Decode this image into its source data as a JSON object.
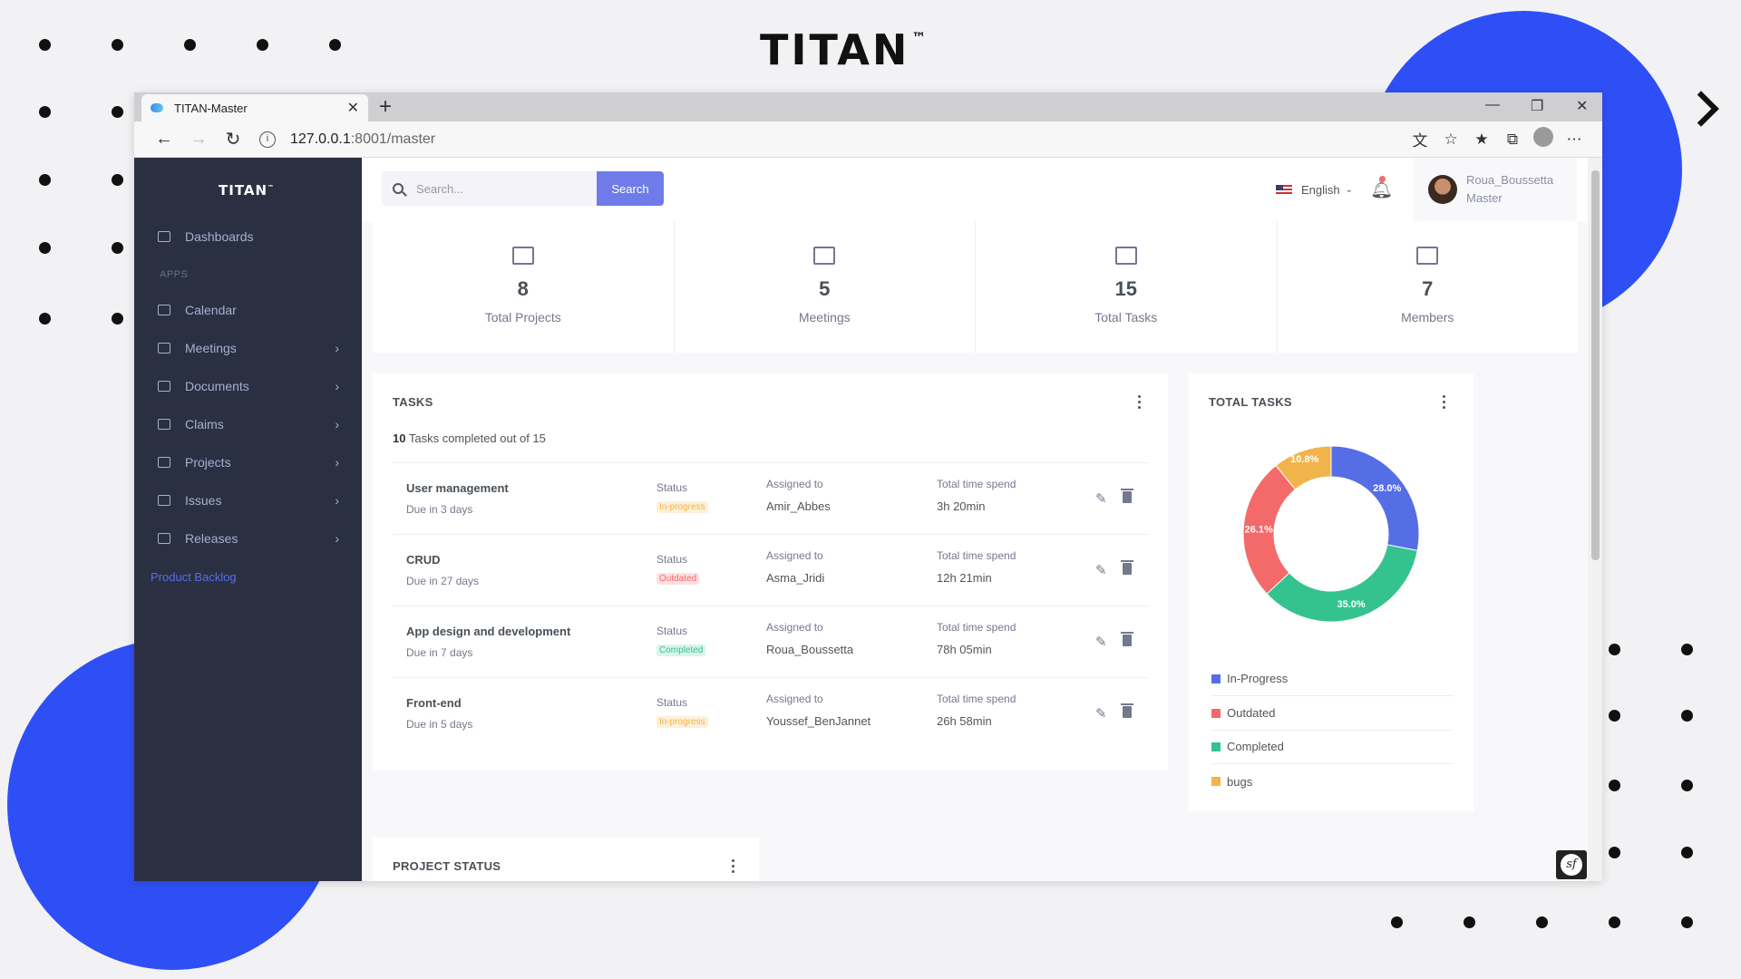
{
  "brand": {
    "name": "TITAN",
    "tm": "™"
  },
  "browser": {
    "tab_title": "TITAN-Master",
    "url_host": "127.0.0.1",
    "url_rest": ":8001/master"
  },
  "sidebar": {
    "brand": "TITAN",
    "brand_tm": "™",
    "items": [
      {
        "label": "Dashboards",
        "icon": "home-icon"
      },
      {
        "label": "Calendar",
        "icon": "calendar-icon"
      },
      {
        "label": "Meetings",
        "icon": "store-icon"
      },
      {
        "label": "Documents",
        "icon": "folder-icon"
      },
      {
        "label": "Claims",
        "icon": "envelope-icon"
      },
      {
        "label": "Projects",
        "icon": "briefcase-icon"
      },
      {
        "label": "Issues",
        "icon": "briefcase-icon"
      },
      {
        "label": "Releases",
        "icon": "briefcase-icon"
      }
    ],
    "section": "APPS",
    "backlog": "Product Backlog"
  },
  "topbar": {
    "search_placeholder": "Search...",
    "search_button": "Search",
    "language": "English",
    "user_name": "Roua_Boussetta",
    "user_role": "Master"
  },
  "stats": [
    {
      "value": "8",
      "label": "Total Projects",
      "icon": "briefcase-icon"
    },
    {
      "value": "5",
      "label": "Meetings",
      "icon": "calendar-icon"
    },
    {
      "value": "15",
      "label": "Total Tasks",
      "icon": "list-icon"
    },
    {
      "value": "7",
      "label": "Members",
      "icon": "users-icon"
    }
  ],
  "tasks": {
    "title": "TASKS",
    "completed": "10",
    "summary_rest": " Tasks completed out of 15",
    "status_label": "Status",
    "assigned_label": "Assigned to",
    "time_label": "Total time spend",
    "rows": [
      {
        "name": "User management",
        "due": "Due in 3 days",
        "status": "In-progress",
        "assigned": "Amir_Abbes",
        "time": "3h 20min"
      },
      {
        "name": "CRUD",
        "due": "Due in 27 days",
        "status": "Outdated",
        "assigned": "Asma_Jridi",
        "time": "12h 21min"
      },
      {
        "name": "App design and development",
        "due": "Due in 7 days",
        "status": "Completed",
        "assigned": "Roua_Boussetta",
        "time": "78h 05min"
      },
      {
        "name": "Front-end",
        "due": "Due in 5 days",
        "status": "In-progress",
        "assigned": "Youssef_BenJannet",
        "time": "26h 58min"
      }
    ]
  },
  "total_tasks": {
    "title": "TOTAL TASKS",
    "legend": [
      "In-Progress",
      "Outdated",
      "Completed",
      "bugs"
    ]
  },
  "chart_data": {
    "type": "pie",
    "categories": [
      "In-Progress",
      "Completed",
      "Outdated",
      "bugs"
    ],
    "values": [
      28.0,
      35.0,
      26.1,
      10.8
    ],
    "labels": [
      "28.0%",
      "35.0%",
      "26.1%",
      "10.8%"
    ],
    "colors": [
      "#556ee6",
      "#34c38f",
      "#f46a6a",
      "#f1b44c"
    ]
  },
  "project_status": {
    "title": "PROJECT STATUS"
  }
}
